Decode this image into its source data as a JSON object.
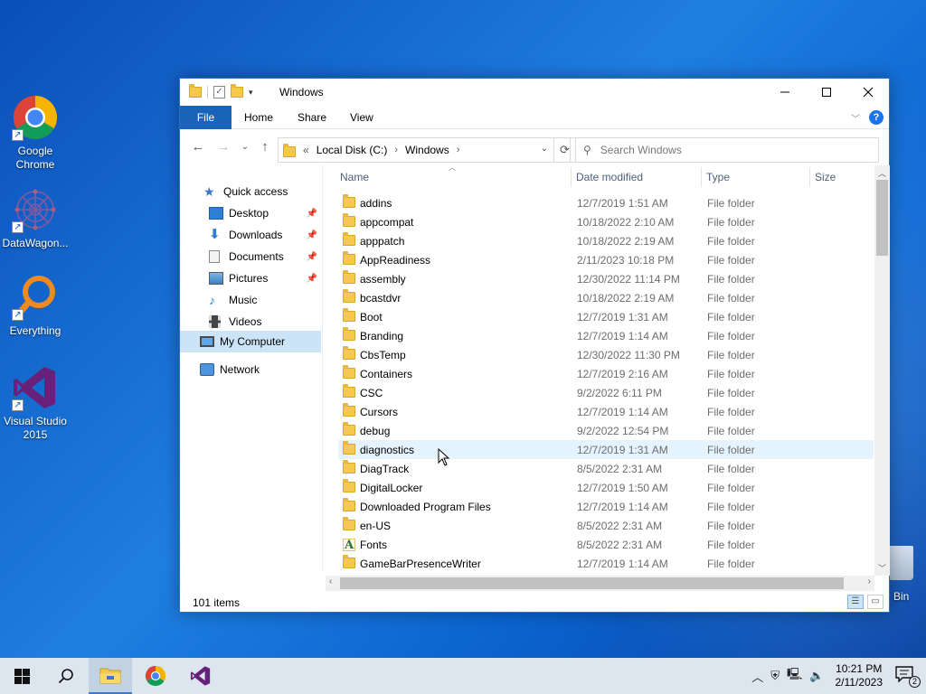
{
  "desktop": {
    "icons": [
      {
        "label": "Google Chrome"
      },
      {
        "label": "DataWagon..."
      },
      {
        "label": "Everything"
      },
      {
        "label": "Visual Studio 2015"
      }
    ],
    "recycle_bin_label": "Bin"
  },
  "window": {
    "title": "Windows",
    "ribbon_tabs": [
      "File",
      "Home",
      "Share",
      "View"
    ],
    "address": {
      "overflow": "«",
      "parts": [
        "Local Disk (C:)",
        "Windows"
      ]
    },
    "search_placeholder": "Search Windows",
    "nav_pane": {
      "quick_access": "Quick access",
      "items": [
        "Desktop",
        "Downloads",
        "Documents",
        "Pictures",
        "Music",
        "Videos"
      ],
      "my_computer": "My Computer",
      "network": "Network"
    },
    "columns": [
      "Name",
      "Date modified",
      "Type",
      "Size"
    ],
    "files": [
      {
        "name": "addins",
        "date": "12/7/2019 1:51 AM",
        "type": "File folder"
      },
      {
        "name": "appcompat",
        "date": "10/18/2022 2:10 AM",
        "type": "File folder"
      },
      {
        "name": "apppatch",
        "date": "10/18/2022 2:19 AM",
        "type": "File folder"
      },
      {
        "name": "AppReadiness",
        "date": "2/11/2023 10:18 PM",
        "type": "File folder"
      },
      {
        "name": "assembly",
        "date": "12/30/2022 11:14 PM",
        "type": "File folder"
      },
      {
        "name": "bcastdvr",
        "date": "10/18/2022 2:19 AM",
        "type": "File folder"
      },
      {
        "name": "Boot",
        "date": "12/7/2019 1:31 AM",
        "type": "File folder"
      },
      {
        "name": "Branding",
        "date": "12/7/2019 1:14 AM",
        "type": "File folder"
      },
      {
        "name": "CbsTemp",
        "date": "12/30/2022 11:30 PM",
        "type": "File folder"
      },
      {
        "name": "Containers",
        "date": "12/7/2019 2:16 AM",
        "type": "File folder"
      },
      {
        "name": "CSC",
        "date": "9/2/2022 6:11 PM",
        "type": "File folder"
      },
      {
        "name": "Cursors",
        "date": "12/7/2019 1:14 AM",
        "type": "File folder"
      },
      {
        "name": "debug",
        "date": "9/2/2022 12:54 PM",
        "type": "File folder"
      },
      {
        "name": "diagnostics",
        "date": "12/7/2019 1:31 AM",
        "type": "File folder"
      },
      {
        "name": "DiagTrack",
        "date": "8/5/2022 2:31 AM",
        "type": "File folder"
      },
      {
        "name": "DigitalLocker",
        "date": "12/7/2019 1:50 AM",
        "type": "File folder"
      },
      {
        "name": "Downloaded Program Files",
        "date": "12/7/2019 1:14 AM",
        "type": "File folder"
      },
      {
        "name": "en-US",
        "date": "8/5/2022 2:31 AM",
        "type": "File folder"
      },
      {
        "name": "Fonts",
        "date": "8/5/2022 2:31 AM",
        "type": "File folder"
      },
      {
        "name": "GameBarPresenceWriter",
        "date": "12/7/2019 1:14 AM",
        "type": "File folder"
      }
    ],
    "status": "101 items"
  },
  "taskbar": {
    "clock_time": "10:21 PM",
    "clock_date": "2/11/2023",
    "notification_count": "2"
  }
}
